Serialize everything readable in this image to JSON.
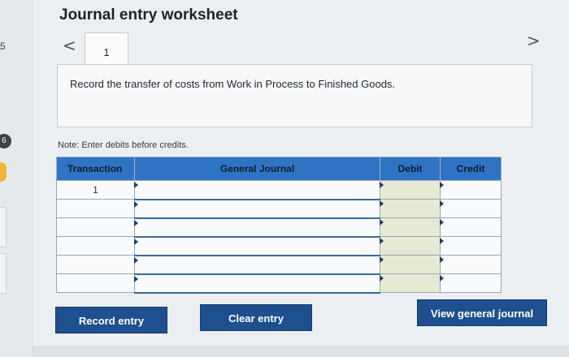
{
  "sidebar": {
    "question_numbers": [
      "5",
      "6"
    ]
  },
  "header": {
    "title": "Journal entry worksheet"
  },
  "navigation": {
    "prev_symbol": "<",
    "next_symbol": ">",
    "tabs": [
      {
        "label": "1"
      }
    ]
  },
  "instruction": {
    "text": "Record the transfer of costs from Work in Process to Finished Goods."
  },
  "note": {
    "text": "Note: Enter debits before credits."
  },
  "table": {
    "headers": [
      "Transaction",
      "General Journal",
      "Debit",
      "Credit"
    ],
    "rows": [
      {
        "transaction": "1",
        "general_journal": "",
        "debit": "",
        "credit": ""
      },
      {
        "transaction": "",
        "general_journal": "",
        "debit": "",
        "credit": ""
      },
      {
        "transaction": "",
        "general_journal": "",
        "debit": "",
        "credit": ""
      },
      {
        "transaction": "",
        "general_journal": "",
        "debit": "",
        "credit": ""
      },
      {
        "transaction": "",
        "general_journal": "",
        "debit": "",
        "credit": ""
      },
      {
        "transaction": "",
        "general_journal": "",
        "debit": "",
        "credit": ""
      }
    ]
  },
  "buttons": {
    "record_entry": "Record entry",
    "clear_entry": "Clear entry",
    "view_general_journal": "View general journal"
  },
  "colors": {
    "header_blue": "#2f73c3",
    "button_navy": "#1e4f8e",
    "debit_fill": "#e6ead2"
  }
}
